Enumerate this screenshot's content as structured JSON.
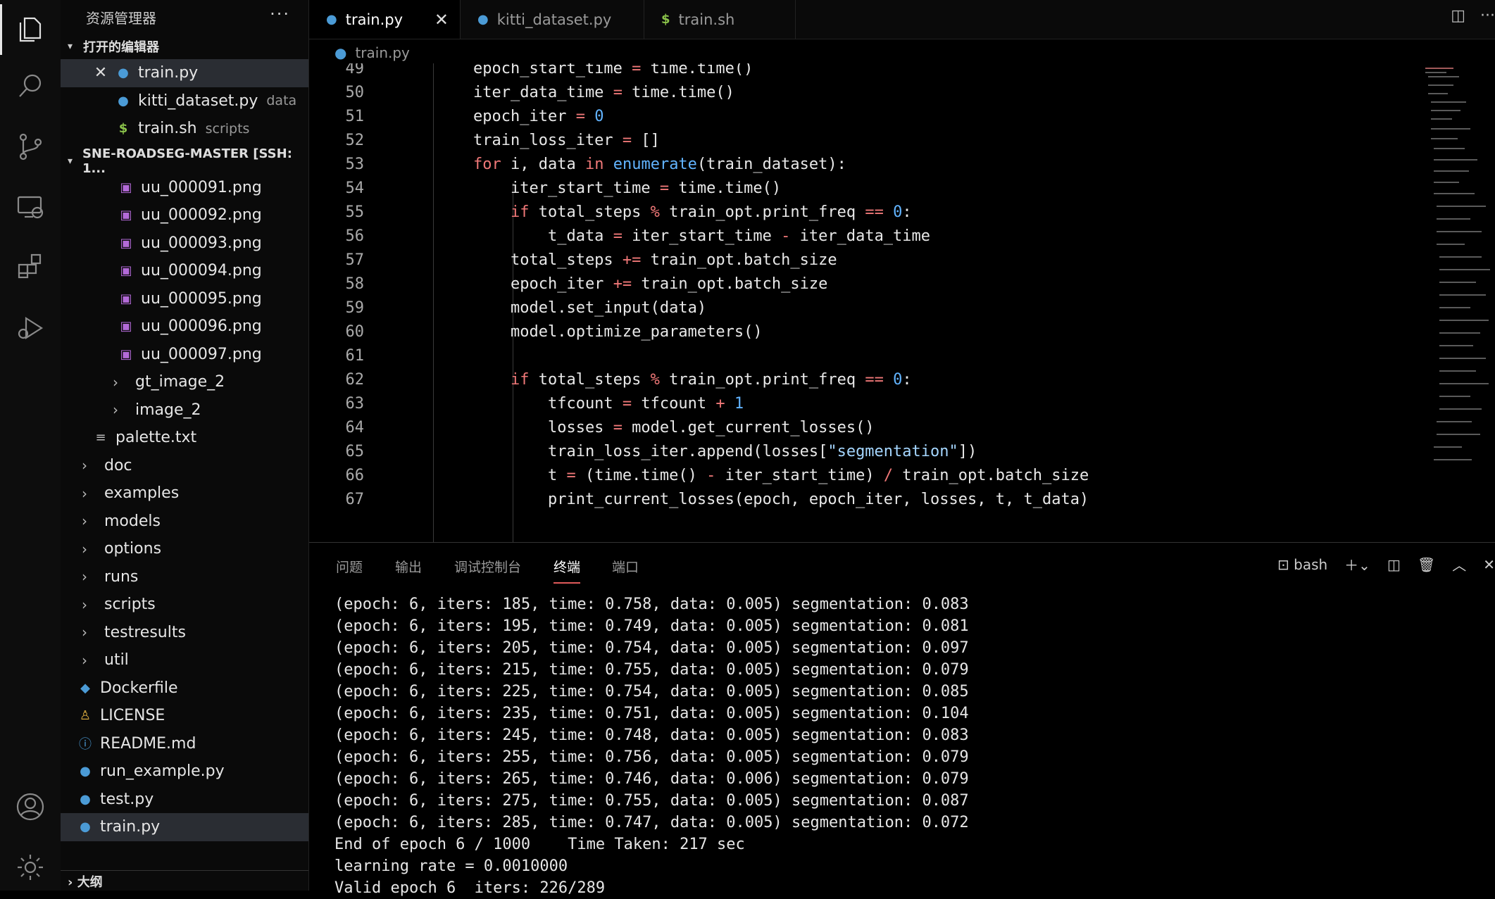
{
  "activity": [
    "explorer-icon",
    "search-icon",
    "source-control-icon",
    "remote-explorer-icon",
    "extensions-icon",
    "run-debug-icon",
    "account-icon",
    "settings-gear-icon"
  ],
  "sidebar": {
    "title": "资源管理器",
    "open_editors": {
      "title": "打开的编辑器",
      "items": [
        {
          "name": "train.py",
          "desc": ""
        },
        {
          "name": "kitti_dataset.py",
          "desc": "data"
        },
        {
          "name": "train.sh",
          "desc": "scripts"
        }
      ]
    },
    "workspace": {
      "title": "SNE-ROADSEG-MASTER [SSH: 1...",
      "images": [
        "uu_000091.png",
        "uu_000092.png",
        "uu_000093.png",
        "uu_000094.png",
        "uu_000095.png",
        "uu_000096.png",
        "uu_000097.png"
      ],
      "subfolders": [
        "gt_image_2",
        "image_2"
      ],
      "palette": "palette.txt",
      "folders": [
        "doc",
        "examples",
        "models",
        "options",
        "runs",
        "scripts",
        "testresults",
        "util"
      ],
      "files": [
        "Dockerfile",
        "LICENSE",
        "README.md",
        "run_example.py",
        "test.py",
        "train.py"
      ]
    },
    "outline": "大纲"
  },
  "tabs": [
    "train.py",
    "kitti_dataset.py",
    "train.sh"
  ],
  "breadcrumb": "train.py",
  "editor": {
    "line_numbers": [
      "49",
      "50",
      "51",
      "52",
      "53",
      "54",
      "55",
      "56",
      "57",
      "58",
      "59",
      "60",
      "61",
      "62",
      "63",
      "64",
      "65",
      "66",
      "67"
    ]
  },
  "panel": {
    "tabs": [
      "问题",
      "输出",
      "调试控制台",
      "终端",
      "端口"
    ],
    "shell": "bash",
    "terminal_lines": [
      "(epoch: 6, iters: 185, time: 0.758, data: 0.005) segmentation: 0.083",
      "(epoch: 6, iters: 195, time: 0.749, data: 0.005) segmentation: 0.081",
      "(epoch: 6, iters: 205, time: 0.754, data: 0.005) segmentation: 0.097",
      "(epoch: 6, iters: 215, time: 0.755, data: 0.005) segmentation: 0.079",
      "(epoch: 6, iters: 225, time: 0.754, data: 0.005) segmentation: 0.085",
      "(epoch: 6, iters: 235, time: 0.751, data: 0.005) segmentation: 0.104",
      "(epoch: 6, iters: 245, time: 0.748, data: 0.005) segmentation: 0.083",
      "(epoch: 6, iters: 255, time: 0.756, data: 0.005) segmentation: 0.079",
      "(epoch: 6, iters: 265, time: 0.746, data: 0.006) segmentation: 0.079",
      "(epoch: 6, iters: 275, time: 0.755, data: 0.005) segmentation: 0.087",
      "(epoch: 6, iters: 285, time: 0.747, data: 0.005) segmentation: 0.072",
      "End of epoch 6 / 1000    Time Taken: 217 sec",
      "learning rate = 0.0010000"
    ],
    "last_line": "Valid epoch 6  iters: 226/289"
  }
}
